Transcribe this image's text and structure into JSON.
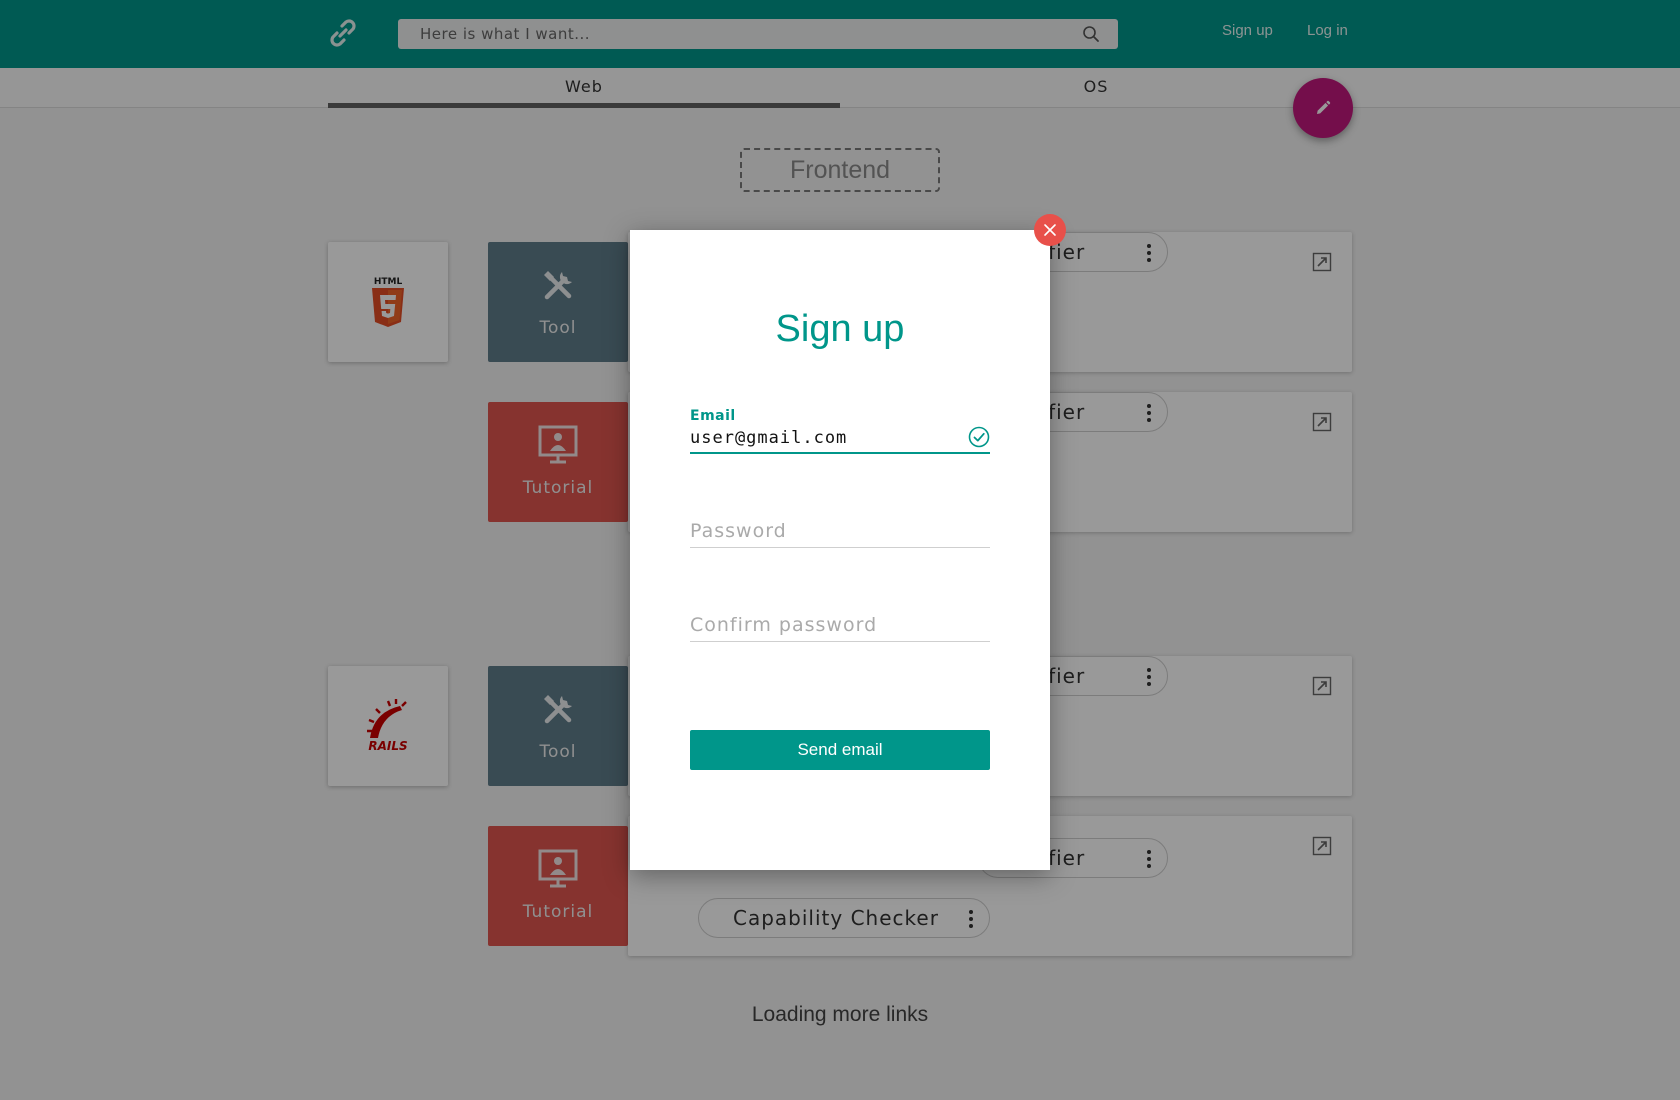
{
  "header": {
    "logo_icon": "link-icon",
    "search_placeholder": "Here is what I want...",
    "search_icon": "search-icon",
    "signup_label": "Sign up",
    "login_label": "Log in",
    "background": "#00968a"
  },
  "tabs": [
    {
      "label": "Web",
      "active": true
    },
    {
      "label": "OS",
      "active": false
    }
  ],
  "fab": {
    "icon": "pencil-icon",
    "color": "#c2187e"
  },
  "section": {
    "label": "Frontend"
  },
  "groups": [
    {
      "tech": {
        "name": "HTML5",
        "icon": "html5-logo"
      },
      "rows": [
        {
          "category": "Tool",
          "icon": "tools-icon",
          "color": "#607d8b",
          "chips": [
            "utifier"
          ]
        },
        {
          "category": "Tutorial",
          "icon": "presentation-icon",
          "color": "#e0554f",
          "chips": [
            "utifier"
          ]
        }
      ]
    },
    {
      "tech": {
        "name": "Rails",
        "icon": "rails-logo"
      },
      "rows": [
        {
          "category": "Tool",
          "icon": "tools-icon",
          "color": "#607d8b",
          "chips": [
            "utifier"
          ]
        },
        {
          "category": "Tutorial",
          "icon": "presentation-icon",
          "color": "#e0554f",
          "chips": [
            "utifier",
            "Capability Checker"
          ]
        }
      ]
    }
  ],
  "loading_text": "Loading more links",
  "modal": {
    "title": "Sign up",
    "email_label": "Email",
    "email_value": "user@gmail.com",
    "password_placeholder": "Password",
    "confirm_placeholder": "Confirm password",
    "submit_label": "Send email",
    "accent": "#00968a",
    "close_color": "#e8504a"
  }
}
